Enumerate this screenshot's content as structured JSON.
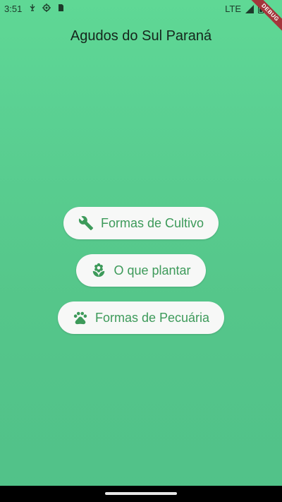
{
  "status_bar": {
    "time": "3:51",
    "network": "LTE",
    "icons": [
      "usb-debug-icon",
      "gps-icon",
      "sim-card-icon",
      "signal-icon",
      "battery-icon"
    ]
  },
  "debug_banner": "DEBUG",
  "app_bar": {
    "title": "Agudos do Sul Paraná"
  },
  "menu": {
    "buttons": [
      {
        "label": "Formas de Cultivo",
        "icon": "wrench-icon"
      },
      {
        "label": "O que plantar",
        "icon": "seedling-icon"
      },
      {
        "label": "Formas de Pecuária",
        "icon": "paw-icon"
      }
    ]
  },
  "colors": {
    "background_top": "#5fd895",
    "background_bottom": "#51c189",
    "button_bg": "#f7f8f7",
    "button_fg": "#3d9a5a",
    "title_text": "#15261c"
  }
}
